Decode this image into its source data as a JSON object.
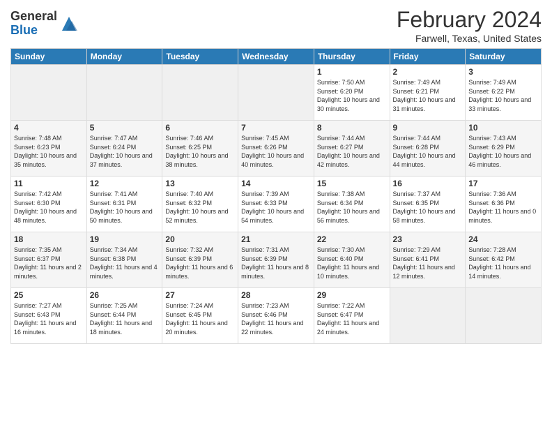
{
  "logo": {
    "general": "General",
    "blue": "Blue"
  },
  "title": "February 2024",
  "location": "Farwell, Texas, United States",
  "days_of_week": [
    "Sunday",
    "Monday",
    "Tuesday",
    "Wednesday",
    "Thursday",
    "Friday",
    "Saturday"
  ],
  "weeks": [
    [
      {
        "day": "",
        "info": ""
      },
      {
        "day": "",
        "info": ""
      },
      {
        "day": "",
        "info": ""
      },
      {
        "day": "",
        "info": ""
      },
      {
        "day": "1",
        "info": "Sunrise: 7:50 AM\nSunset: 6:20 PM\nDaylight: 10 hours and 30 minutes."
      },
      {
        "day": "2",
        "info": "Sunrise: 7:49 AM\nSunset: 6:21 PM\nDaylight: 10 hours and 31 minutes."
      },
      {
        "day": "3",
        "info": "Sunrise: 7:49 AM\nSunset: 6:22 PM\nDaylight: 10 hours and 33 minutes."
      }
    ],
    [
      {
        "day": "4",
        "info": "Sunrise: 7:48 AM\nSunset: 6:23 PM\nDaylight: 10 hours and 35 minutes."
      },
      {
        "day": "5",
        "info": "Sunrise: 7:47 AM\nSunset: 6:24 PM\nDaylight: 10 hours and 37 minutes."
      },
      {
        "day": "6",
        "info": "Sunrise: 7:46 AM\nSunset: 6:25 PM\nDaylight: 10 hours and 38 minutes."
      },
      {
        "day": "7",
        "info": "Sunrise: 7:45 AM\nSunset: 6:26 PM\nDaylight: 10 hours and 40 minutes."
      },
      {
        "day": "8",
        "info": "Sunrise: 7:44 AM\nSunset: 6:27 PM\nDaylight: 10 hours and 42 minutes."
      },
      {
        "day": "9",
        "info": "Sunrise: 7:44 AM\nSunset: 6:28 PM\nDaylight: 10 hours and 44 minutes."
      },
      {
        "day": "10",
        "info": "Sunrise: 7:43 AM\nSunset: 6:29 PM\nDaylight: 10 hours and 46 minutes."
      }
    ],
    [
      {
        "day": "11",
        "info": "Sunrise: 7:42 AM\nSunset: 6:30 PM\nDaylight: 10 hours and 48 minutes."
      },
      {
        "day": "12",
        "info": "Sunrise: 7:41 AM\nSunset: 6:31 PM\nDaylight: 10 hours and 50 minutes."
      },
      {
        "day": "13",
        "info": "Sunrise: 7:40 AM\nSunset: 6:32 PM\nDaylight: 10 hours and 52 minutes."
      },
      {
        "day": "14",
        "info": "Sunrise: 7:39 AM\nSunset: 6:33 PM\nDaylight: 10 hours and 54 minutes."
      },
      {
        "day": "15",
        "info": "Sunrise: 7:38 AM\nSunset: 6:34 PM\nDaylight: 10 hours and 56 minutes."
      },
      {
        "day": "16",
        "info": "Sunrise: 7:37 AM\nSunset: 6:35 PM\nDaylight: 10 hours and 58 minutes."
      },
      {
        "day": "17",
        "info": "Sunrise: 7:36 AM\nSunset: 6:36 PM\nDaylight: 11 hours and 0 minutes."
      }
    ],
    [
      {
        "day": "18",
        "info": "Sunrise: 7:35 AM\nSunset: 6:37 PM\nDaylight: 11 hours and 2 minutes."
      },
      {
        "day": "19",
        "info": "Sunrise: 7:34 AM\nSunset: 6:38 PM\nDaylight: 11 hours and 4 minutes."
      },
      {
        "day": "20",
        "info": "Sunrise: 7:32 AM\nSunset: 6:39 PM\nDaylight: 11 hours and 6 minutes."
      },
      {
        "day": "21",
        "info": "Sunrise: 7:31 AM\nSunset: 6:39 PM\nDaylight: 11 hours and 8 minutes."
      },
      {
        "day": "22",
        "info": "Sunrise: 7:30 AM\nSunset: 6:40 PM\nDaylight: 11 hours and 10 minutes."
      },
      {
        "day": "23",
        "info": "Sunrise: 7:29 AM\nSunset: 6:41 PM\nDaylight: 11 hours and 12 minutes."
      },
      {
        "day": "24",
        "info": "Sunrise: 7:28 AM\nSunset: 6:42 PM\nDaylight: 11 hours and 14 minutes."
      }
    ],
    [
      {
        "day": "25",
        "info": "Sunrise: 7:27 AM\nSunset: 6:43 PM\nDaylight: 11 hours and 16 minutes."
      },
      {
        "day": "26",
        "info": "Sunrise: 7:25 AM\nSunset: 6:44 PM\nDaylight: 11 hours and 18 minutes."
      },
      {
        "day": "27",
        "info": "Sunrise: 7:24 AM\nSunset: 6:45 PM\nDaylight: 11 hours and 20 minutes."
      },
      {
        "day": "28",
        "info": "Sunrise: 7:23 AM\nSunset: 6:46 PM\nDaylight: 11 hours and 22 minutes."
      },
      {
        "day": "29",
        "info": "Sunrise: 7:22 AM\nSunset: 6:47 PM\nDaylight: 11 hours and 24 minutes."
      },
      {
        "day": "",
        "info": ""
      },
      {
        "day": "",
        "info": ""
      }
    ]
  ]
}
